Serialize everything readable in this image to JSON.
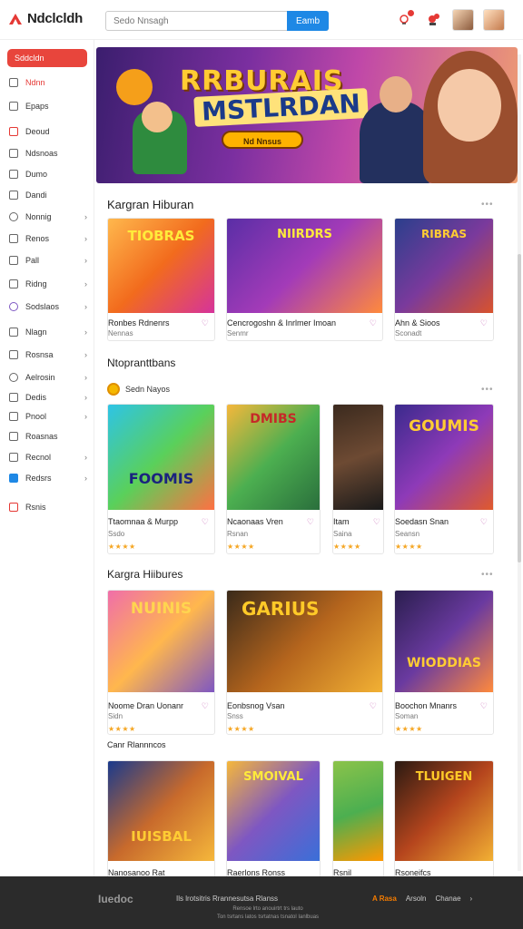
{
  "header": {
    "logo_text": "Ndclcldh",
    "search_placeholder": "Sedo Nnsagh",
    "search_button": "Eamb",
    "icons": [
      "notification-icon",
      "gift-icon"
    ]
  },
  "sidebar": {
    "button_label": "Sddcldn",
    "items": [
      {
        "label": "Ndnn",
        "icon": "home-icon",
        "active": true,
        "chevron": false
      },
      {
        "label": "Epaps",
        "icon": "list-icon",
        "chevron": false
      },
      {
        "label": "Deoud",
        "icon": "flame-icon",
        "chevron": false
      },
      {
        "label": "Ndsnoas",
        "icon": "star-icon",
        "chevron": false
      },
      {
        "label": "Dumo",
        "icon": "doc-icon",
        "chevron": false
      },
      {
        "label": "Dandi",
        "icon": "folder-icon",
        "chevron": false
      },
      {
        "label": "Nonnig",
        "icon": "clock-icon",
        "chevron": true
      },
      {
        "label": "Renos",
        "icon": "grid-icon",
        "chevron": true
      },
      {
        "label": "Pall",
        "icon": "chat-icon",
        "chevron": true
      },
      {
        "label": "Ridng",
        "icon": "chart-icon",
        "chevron": true
      },
      {
        "label": "Sodslaos",
        "icon": "globe-icon",
        "chevron": true
      },
      {
        "label": "Nlagn",
        "icon": "tag-icon",
        "chevron": true
      },
      {
        "label": "Rosnsa",
        "icon": "box-icon",
        "chevron": true
      },
      {
        "label": "Aelrosin",
        "icon": "info-icon",
        "chevron": true
      },
      {
        "label": "Dedis",
        "icon": "user-icon",
        "chevron": true
      },
      {
        "label": "Pnool",
        "icon": "calendar-icon",
        "chevron": true
      },
      {
        "label": "Roasnas",
        "icon": "mail-icon",
        "chevron": true
      },
      {
        "label": "Recnol",
        "icon": "lock-icon",
        "chevron": true
      },
      {
        "label": "Redsrs",
        "icon": "bookmark-icon",
        "chevron": true
      },
      {
        "label": "Rsnis",
        "icon": "logout-icon",
        "chevron": false
      }
    ]
  },
  "banner": {
    "title_line1": "RRBURAIS",
    "title_line2": "MSTLRDAN",
    "cta": "Nd Nnsus"
  },
  "sections": [
    {
      "title": "Kargran Hiburan",
      "more": "•••",
      "cards": [
        {
          "art": "TIOBRAS",
          "name": "Ronbes Rdnenrs",
          "sub": "Nennas",
          "stars": "★★★★",
          "heart": "♡"
        },
        {
          "art": "NIIRDRS",
          "name": "Cencrogoshn & Inrlmer Imoan",
          "sub": "Senmr",
          "stars": "★★★★",
          "heart": "♡"
        },
        {
          "art": "RIBRAS",
          "name": "Ahn & Sioos",
          "sub": "Sconadt",
          "stars": "★★★★",
          "heart": "♡"
        }
      ]
    },
    {
      "title": "Ntopranttbans",
      "more": "•••",
      "subtitle": "Sedn Nayos",
      "cards": [
        {
          "art": "FOOMIS",
          "name": "Ttaomnaa & Murpp",
          "sub": "Ssdo",
          "stars": "★★★★",
          "heart": "♡"
        },
        {
          "art": "DMIBS",
          "name": "Ncaonaas Vren",
          "sub": "Rsnan",
          "stars": "★★★★",
          "heart": "♡"
        },
        {
          "art": "",
          "name": "Itam",
          "sub": "Saina",
          "stars": "★★★★",
          "heart": "♡"
        },
        {
          "art": "GOUMIS",
          "name": "Soedasn Snan",
          "sub": "Seansn",
          "stars": "★★★★",
          "heart": "♡"
        }
      ]
    },
    {
      "title": "Kargra Hiibures",
      "more": "•••",
      "cards": [
        {
          "art": "NUINIS",
          "name": "Noome Dran Uonanr",
          "sub": "Sidn",
          "stars": "★★★★",
          "heart": "♡"
        },
        {
          "art": "GARIUS",
          "name": "Eonbsnog Vsan",
          "sub": "Snss",
          "stars": "★★★★",
          "heart": "♡"
        },
        {
          "art": "WIODDIAS",
          "name": "Boochon Mnanrs",
          "sub": "Soman",
          "stars": "★★★★",
          "heart": "♡"
        }
      ]
    },
    {
      "title": "Canr Rlannncos",
      "cards": [
        {
          "art": "IUISBAL",
          "name": "Nanosanoo Rat"
        },
        {
          "art": "SMOIVAL",
          "name": "Raerlons Ronss"
        },
        {
          "art": "",
          "name": "Rsnil"
        },
        {
          "art": "TLUIGEN",
          "name": "Rsoneifcs"
        }
      ]
    }
  ],
  "footer": {
    "logo": "Iuedoc",
    "links": "Ils lrotsitris   Rrannesutsa   Rlanss",
    "line1": "Rensoe lrto anouirtrt trs lauto",
    "line2": "Ton tsrtans latos tsrtatnas tsnatol Ianlbuas",
    "right_a": "A Rasa",
    "right_b": "Arsoln",
    "right_c": "Chanae"
  },
  "colors": {
    "accent": "#e8453c",
    "primary": "#1e88e5",
    "star": "#f5a623",
    "footer_bg": "#2b2b2b"
  }
}
